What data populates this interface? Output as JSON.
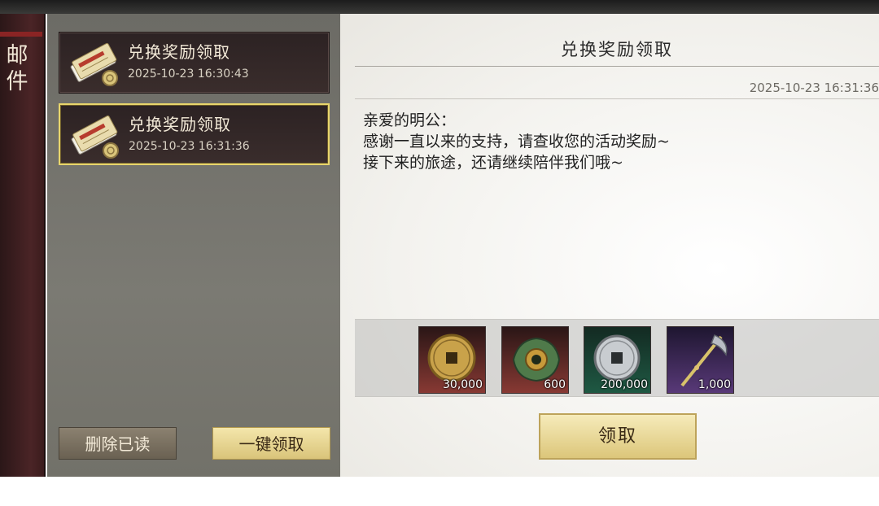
{
  "tab": {
    "label": "邮件"
  },
  "mail_list": [
    {
      "title": "兑换奖励领取",
      "time": "2025-10-23 16:30:43",
      "selected": false
    },
    {
      "title": "兑换奖励领取",
      "time": "2025-10-23 16:31:36",
      "selected": true
    }
  ],
  "buttons": {
    "delete_read": "删除已读",
    "claim_all": "一键领取",
    "claim": "领取"
  },
  "detail": {
    "title": "兑换奖励领取",
    "time": "2025-10-23 16:31:36",
    "body": [
      "亲爱的明公：",
      "感谢一直以来的支持，请查收您的活动奖励~",
      "接下来的旅途，还请继续陪伴我们哦~"
    ]
  },
  "rewards": [
    {
      "icon": "gold-coin-icon",
      "quantity": "30,000",
      "background": "#8a3a34"
    },
    {
      "icon": "jade-ring-icon",
      "quantity": "600",
      "background": "#8a3a34"
    },
    {
      "icon": "silver-coin-icon",
      "quantity": "200,000",
      "background": "#1f5a44"
    },
    {
      "icon": "spear-icon",
      "quantity": "1,000",
      "background": "#5a3a7a"
    }
  ],
  "colors": {
    "selected_border": "#e8d56b",
    "tab_bg": "#4a2426"
  }
}
